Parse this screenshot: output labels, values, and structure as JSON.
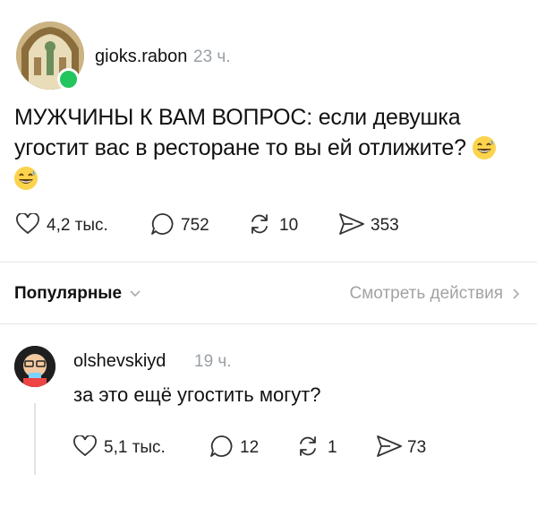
{
  "post": {
    "username": "gioks.rabon",
    "time": "23 ч.",
    "text": "МУЖЧИНЫ К ВАМ ВОПРОС: если девушка угостит вас в ресторане то вы ей отлижите?",
    "stats": {
      "likes": "4,2 тыс.",
      "comments": "752",
      "reposts": "10",
      "shares": "353"
    }
  },
  "sort": {
    "label": "Популярные",
    "actions_link": "Смотреть действия"
  },
  "reply": {
    "username": "olshevskiyd",
    "time": "19 ч.",
    "text": "за это ещё угостить могут?",
    "stats": {
      "likes": "5,1 тыс.",
      "comments": "12",
      "reposts": "1",
      "shares": "73"
    }
  },
  "colors": {
    "online": "#22c55e",
    "muted": "#9aa0a6",
    "emoji": "#fcd34d"
  },
  "icons": [
    "heart-icon",
    "comment-icon",
    "repost-icon",
    "share-icon",
    "chevron-down-icon",
    "chevron-right-icon",
    "grinning-sweat-emoji"
  ]
}
